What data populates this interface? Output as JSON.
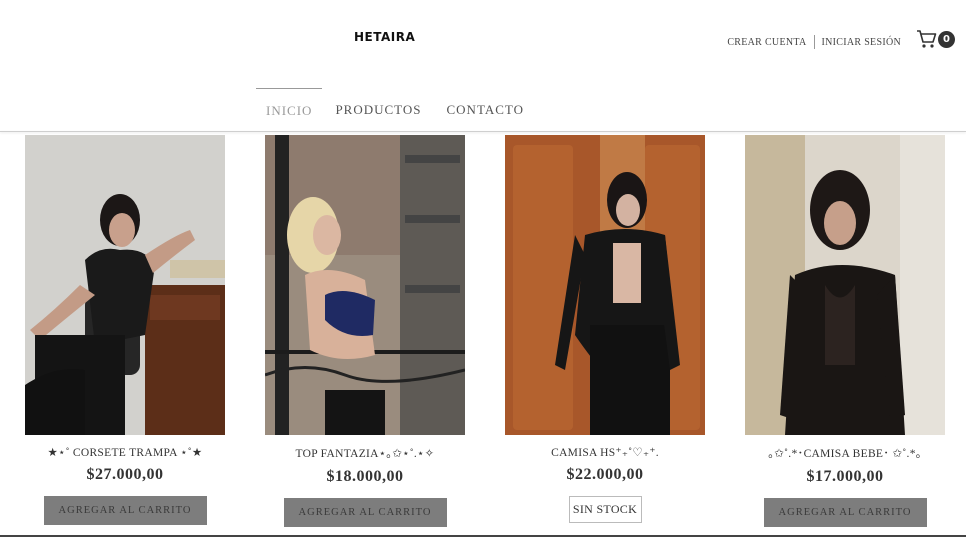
{
  "header": {
    "logo": "HETAIRA",
    "create_account": "CREAR CUENTA",
    "login": "INICIAR SESIÓN",
    "cart_count": "0"
  },
  "nav": {
    "items": [
      {
        "label": "INICIO",
        "active": true
      },
      {
        "label": "PRODUCTOS",
        "active": false
      },
      {
        "label": "CONTACTO",
        "active": false
      }
    ]
  },
  "products": [
    {
      "name": "★⋆˚ CORSETE TRAMPA ⋆˚★",
      "price": "$27.000,00",
      "action": "AGREGAR AL CARRITO",
      "in_stock": true
    },
    {
      "name": "TOP FANTAZIA⋆｡✩⋆˚.⋆✧",
      "price": "$18.000,00",
      "action": "AGREGAR AL CARRITO",
      "in_stock": true
    },
    {
      "name": "CAMISA HS⁺₊˚♡₊⁺.",
      "price": "$22.000,00",
      "action": "SIN STOCK",
      "in_stock": false
    },
    {
      "name": "｡✩˚.*･CAMISA BEBE･ ✩˚.*｡",
      "price": "$17.000,00",
      "action": "AGREGAR AL CARRITO",
      "in_stock": true
    }
  ]
}
